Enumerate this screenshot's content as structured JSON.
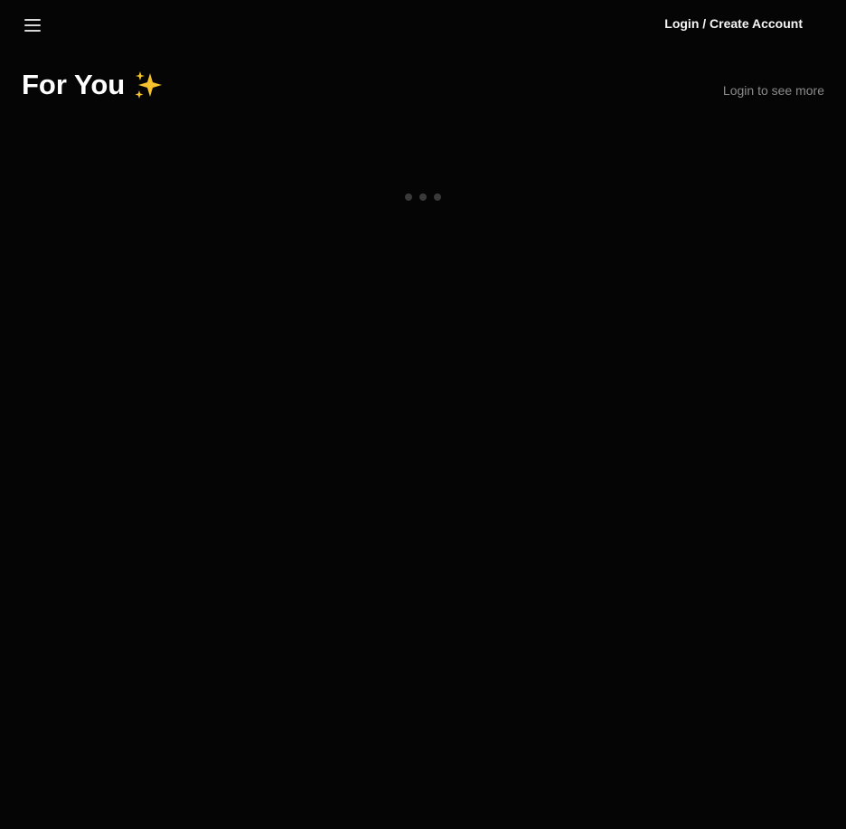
{
  "topbar": {
    "menu_icon": "hamburger-menu-icon",
    "login_label": "Login / Create Account"
  },
  "header": {
    "title": "For You",
    "title_icon": "sparkles-icon",
    "login_hint": "Login to see more"
  },
  "content": {
    "loading_icon": "loading-dots-icon"
  },
  "colors": {
    "background": "#050505",
    "text_primary": "#ffffff",
    "text_muted": "#8a8a8a",
    "sparkle": "#f5c22e",
    "dots": "#3a3a3a"
  }
}
